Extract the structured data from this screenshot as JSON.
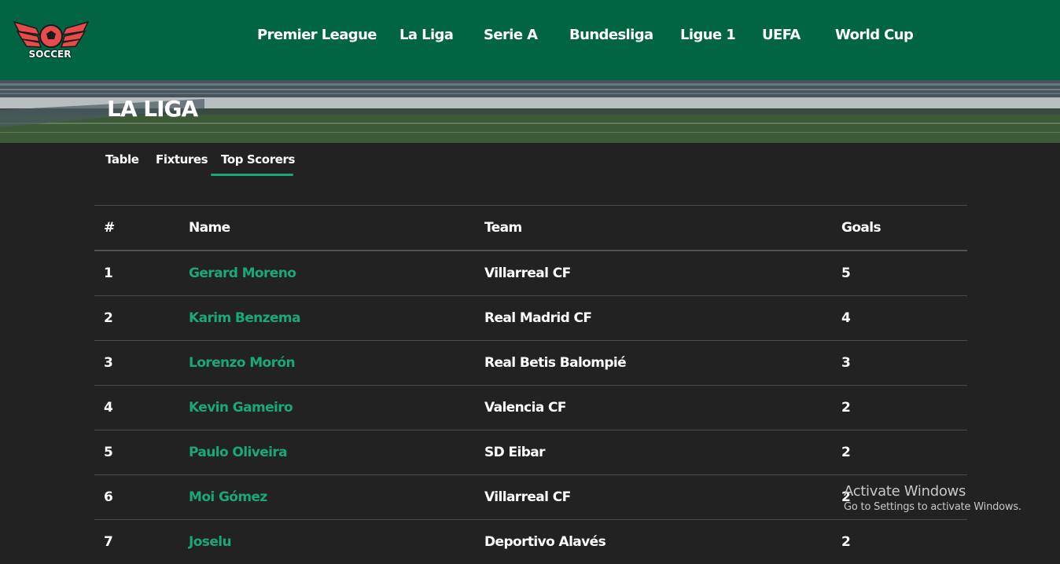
{
  "logo": {
    "text": "SOCCER"
  },
  "nav": {
    "items": [
      {
        "label": "Premier League"
      },
      {
        "label": "La Liga"
      },
      {
        "label": "Serie A"
      },
      {
        "label": "Bundesliga"
      },
      {
        "label": "Ligue 1"
      },
      {
        "label": "UEFA"
      },
      {
        "label": "World Cup"
      }
    ]
  },
  "hero": {
    "title": "LA LIGA"
  },
  "tabs": {
    "items": [
      {
        "label": "Table"
      },
      {
        "label": "Fixtures"
      },
      {
        "label": "Top Scorers"
      }
    ],
    "active": "Top Scorers"
  },
  "scorers": {
    "headers": {
      "rank": "#",
      "name": "Name",
      "team": "Team",
      "goals": "Goals"
    },
    "rows": [
      {
        "rank": "1",
        "name": "Gerard Moreno",
        "team": "Villarreal CF",
        "goals": "5"
      },
      {
        "rank": "2",
        "name": "Karim Benzema",
        "team": "Real Madrid CF",
        "goals": "4"
      },
      {
        "rank": "3",
        "name": "Lorenzo Morón",
        "team": "Real Betis Balompié",
        "goals": "3"
      },
      {
        "rank": "4",
        "name": "Kevin Gameiro",
        "team": "Valencia CF",
        "goals": "2"
      },
      {
        "rank": "5",
        "name": "Paulo Oliveira",
        "team": "SD Eibar",
        "goals": "2"
      },
      {
        "rank": "6",
        "name": "Moi Gómez",
        "team": "Villarreal CF",
        "goals": "2"
      },
      {
        "rank": "7",
        "name": "Joselu",
        "team": "Deportivo Alavés",
        "goals": "2"
      }
    ]
  },
  "watermark": {
    "line1": "Activate Windows",
    "line2": "Go to Settings to activate Windows."
  },
  "colors": {
    "header_bg": "#016443",
    "page_bg": "#222222",
    "accent": "#1aa87a",
    "logo_red": "#e84b4b"
  }
}
